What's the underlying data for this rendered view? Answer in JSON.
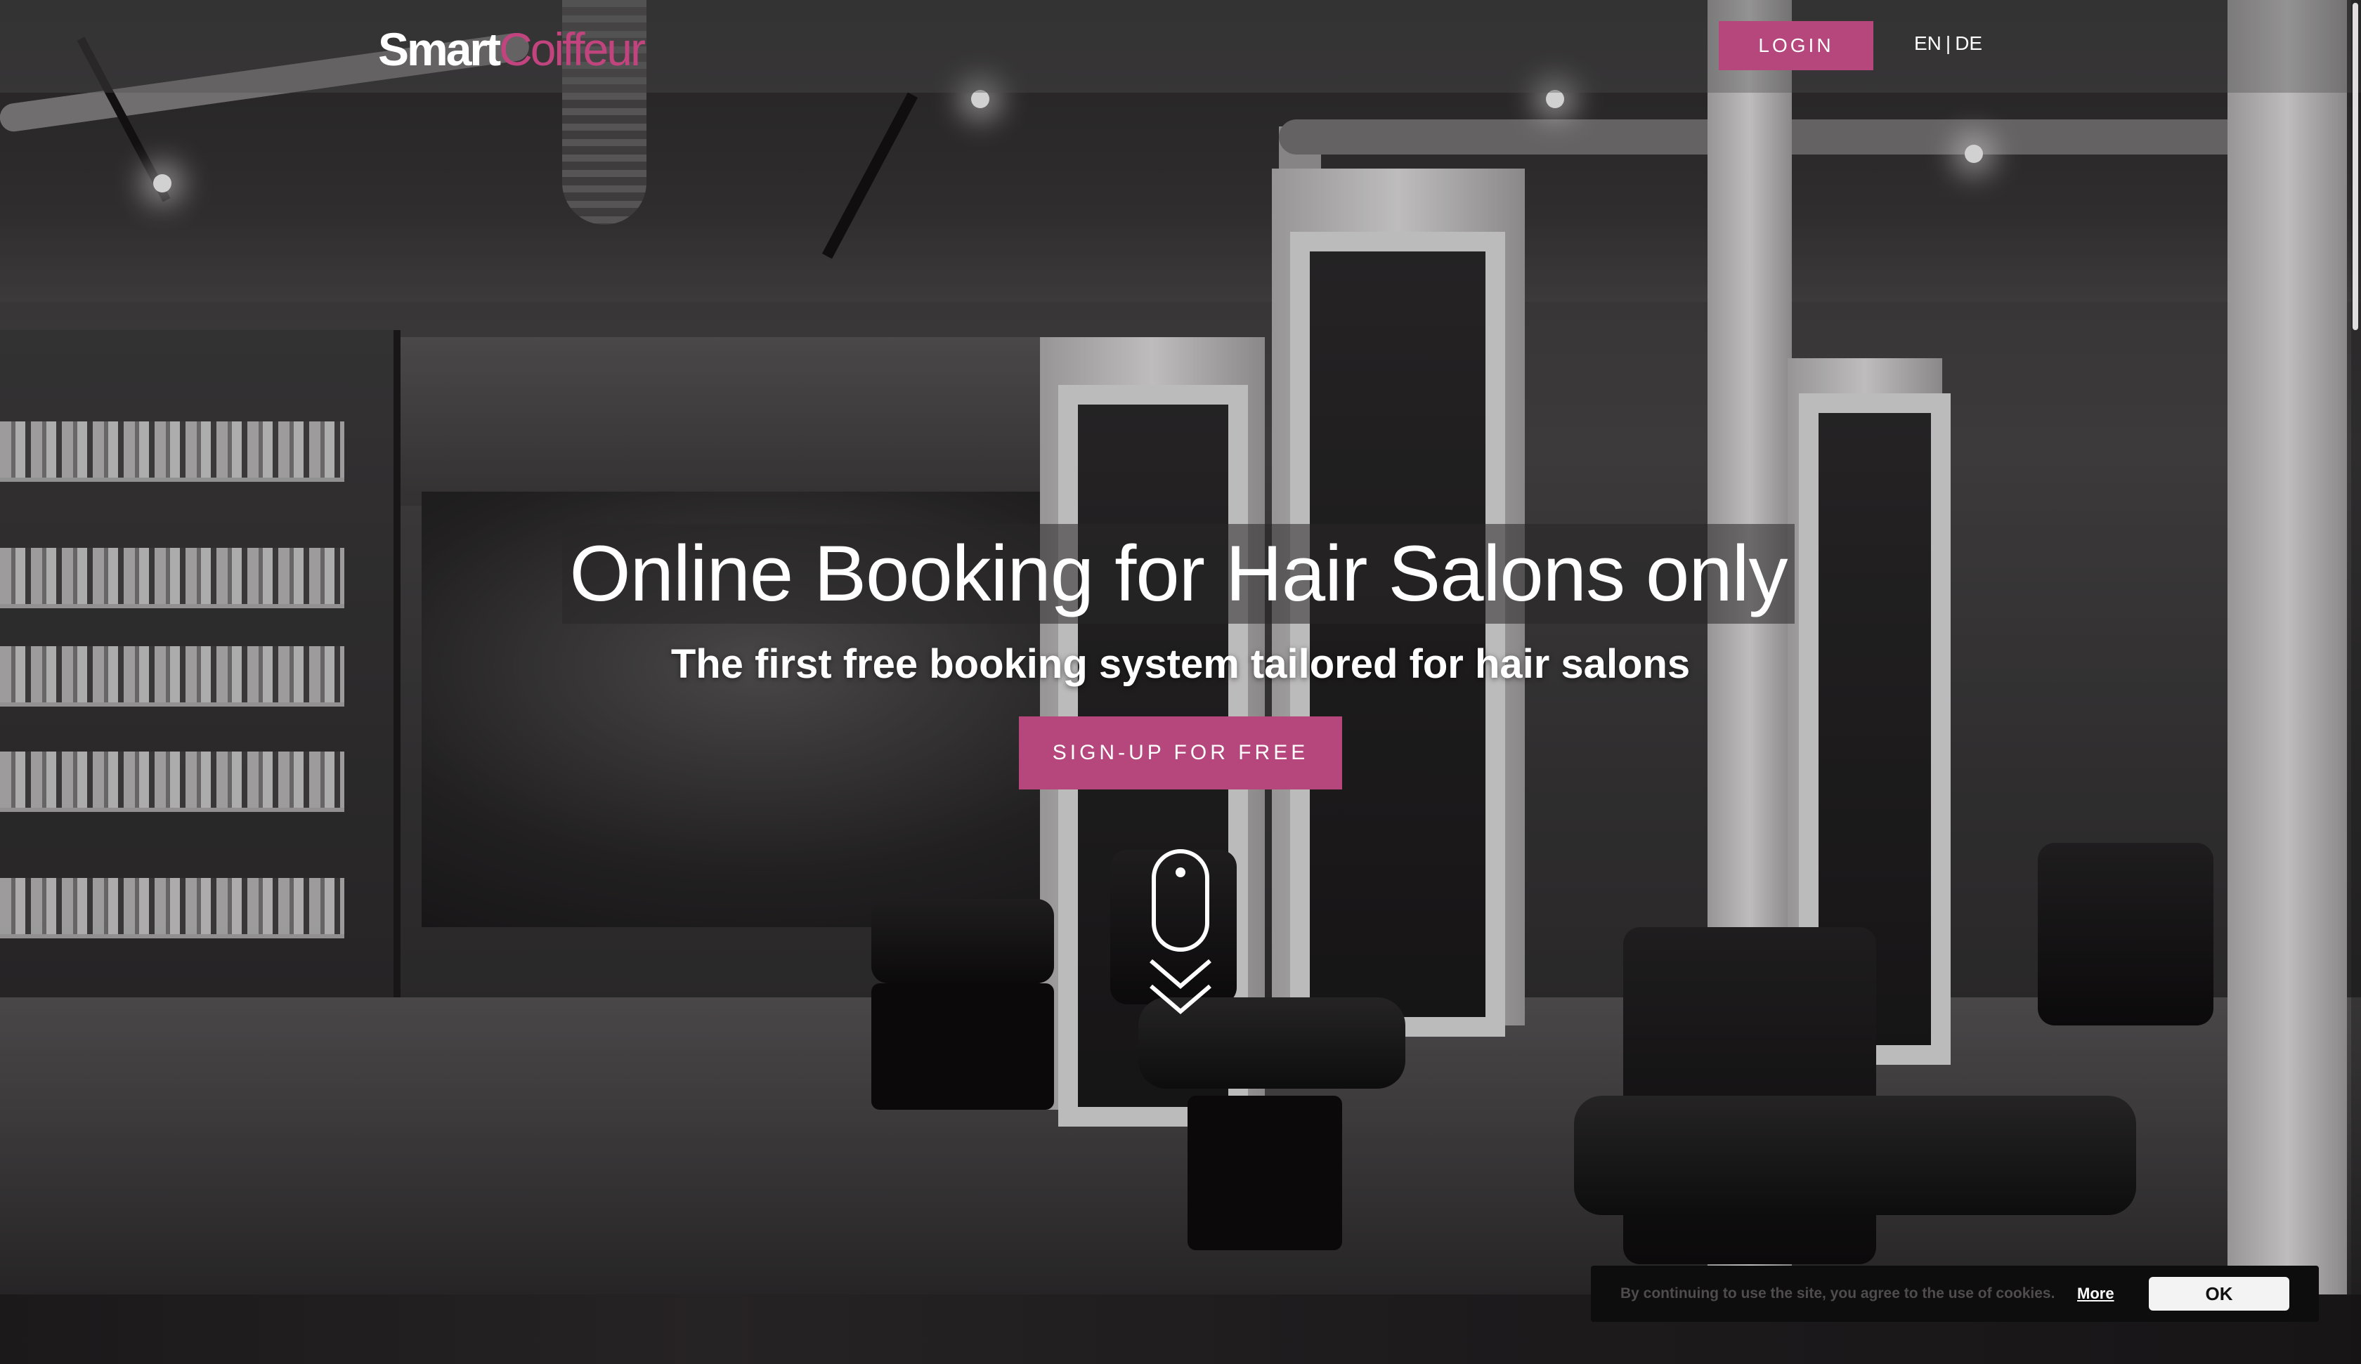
{
  "brand": {
    "part1": "Smart",
    "part2": "Coiffeur",
    "accent_color": "#b5477c",
    "logo_accent_color": "#c2447f"
  },
  "nav": {
    "login_label": "LOGIN",
    "languages": [
      {
        "label": "EN"
      },
      {
        "label": "DE"
      }
    ],
    "lang_separator": "|"
  },
  "hero": {
    "headline": "Online Booking for Hair Salons only",
    "subheadline": "The first free booking system tailored for hair salons",
    "cta_label": "SIGN-UP FOR FREE",
    "scroll_icon": "mouse-scroll-down-icon"
  },
  "cookie_banner": {
    "text": "By continuing to use the site, you agree to the use of cookies.",
    "more_label": "More",
    "ok_label": "OK"
  }
}
